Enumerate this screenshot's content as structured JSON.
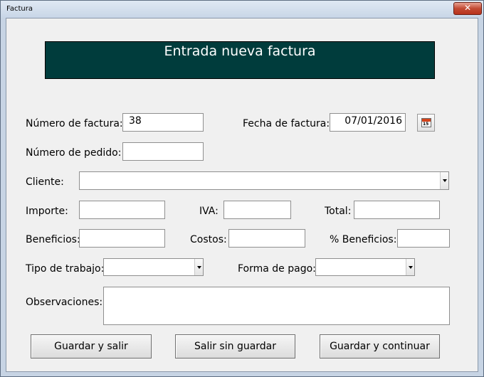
{
  "window": {
    "title": "Factura",
    "close_glyph": "✕"
  },
  "banner": {
    "text": "Entrada nueva factura"
  },
  "fields": {
    "numero_factura": {
      "label": "Número de factura:",
      "value": "38"
    },
    "fecha_factura": {
      "label": "Fecha de factura:",
      "value": "07/01/2016"
    },
    "numero_pedido": {
      "label": "Número de pedido:",
      "value": ""
    },
    "cliente": {
      "label": "Cliente:",
      "value": ""
    },
    "importe": {
      "label": "Importe:",
      "value": ""
    },
    "iva": {
      "label": "IVA:",
      "value": ""
    },
    "total": {
      "label": "Total:",
      "value": ""
    },
    "beneficios": {
      "label": "Beneficios:",
      "value": ""
    },
    "costos": {
      "label": "Costos:",
      "value": ""
    },
    "pct_beneficios": {
      "label": "% Beneficios:",
      "value": ""
    },
    "tipo_trabajo": {
      "label": "Tipo de trabajo:",
      "value": ""
    },
    "forma_pago": {
      "label": "Forma de pago:",
      "value": ""
    },
    "observaciones": {
      "label": "Observaciones:",
      "value": ""
    }
  },
  "calendar": {
    "icon": "calendar-icon",
    "day": "15"
  },
  "buttons": {
    "save_exit": "Guardar y salir",
    "exit_no_save": "Salir sin guardar",
    "save_continue": "Guardar y continuar"
  }
}
